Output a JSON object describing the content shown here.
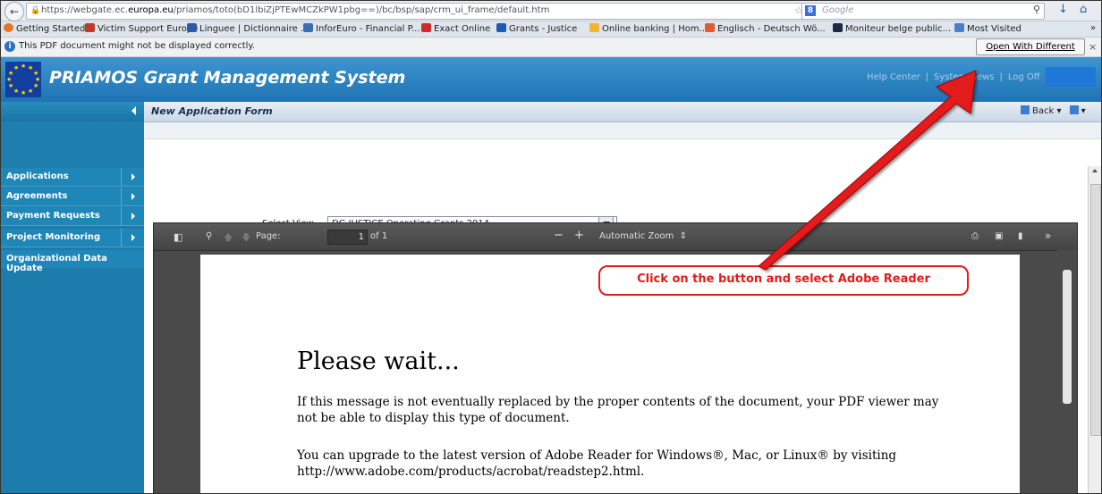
{
  "browser": {
    "url_prefix": "https://webgate.ec.",
    "url_domain": "europa.eu",
    "url_path": "/priamos/toto(bD1lbiZjPTEwMCZkPW1pbg==)/bc/bsp/sap/crm_ui_frame/default.htm",
    "search_placeholder": "Google",
    "bookmarks": [
      "Getting Started",
      "Victim Support Europe",
      "Linguee | Dictionnaire ...",
      "InforEuro - Financial P...",
      "Exact Online",
      "Grants - Justice",
      "Online banking | Hom...",
      "Englisch - Deutsch Wö...",
      "Moniteur belge public...",
      "Most Visited"
    ],
    "overflow": "»"
  },
  "notice": {
    "text": "This PDF document might not be displayed correctly.",
    "button": "Open With Different Viewer",
    "close": "×"
  },
  "app": {
    "title": "PRIAMOS Grant Management System",
    "links": [
      "Help Center",
      "System News",
      "Log Off"
    ]
  },
  "content": {
    "title": "New Application Form",
    "back": "Back"
  },
  "sidebar": {
    "items": [
      "Applications",
      "Agreements",
      "Payment Requests",
      "Project Monitoring",
      "Organizational Data Update"
    ]
  },
  "select_view": {
    "label": "Select View",
    "value": "DG JUSTICE Operating Grants 2014"
  },
  "pdf": {
    "page_label": "Page:",
    "page_value": "1",
    "page_of": "of 1",
    "zoom": "Automatic Zoom",
    "heading": "Please wait...",
    "para1": "If this message is not eventually replaced by the proper contents of the document, your PDF viewer may not be able to display this type of document.",
    "para2": "You can upgrade to the latest version of Adobe Reader for Windows®, Mac, or Linux® by visiting http://www.adobe.com/products/acrobat/readstep2.html."
  },
  "annotation": {
    "text": "Click on the button and select Adobe Reader",
    "color": "#e21b1b"
  }
}
